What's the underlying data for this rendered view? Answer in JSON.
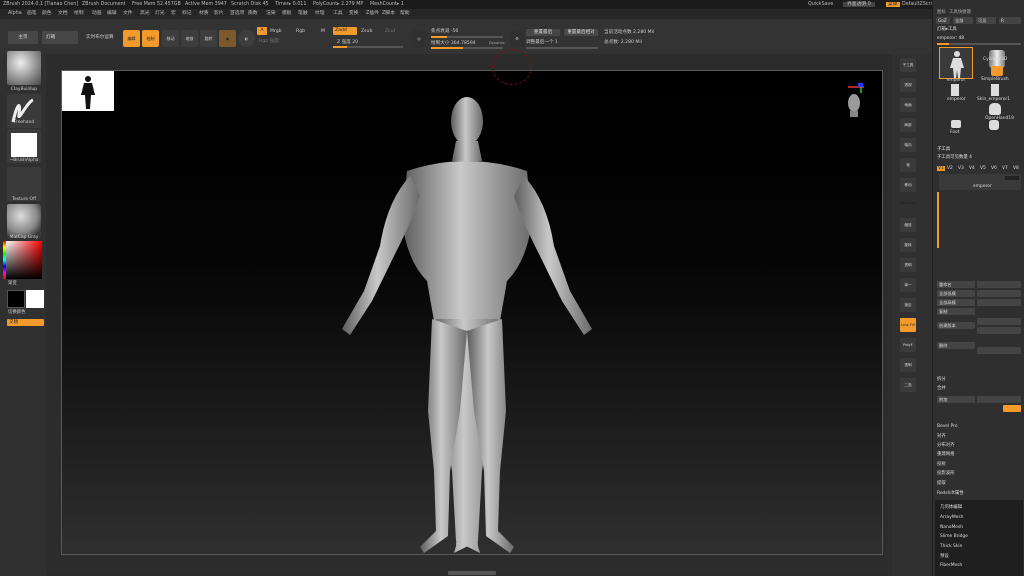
{
  "titlebar": {
    "app": "ZBrush 2024.0.1 [Tianao Chen]",
    "doc": "ZBrush Document",
    "free_mem": "Free Mem 52.457GB",
    "active_mem": "Active Mem 3947",
    "scratch": "Scratch Disk 45",
    "timer": "Timer▸ 0.011",
    "polycount": "PolyCount▸ 2.279 MP",
    "meshcount": "MeshCount▸ 1",
    "quicksave": "QuickSave",
    "transparency": "界面透明 0",
    "menu_label": "菜单",
    "script": "DefaultZScript"
  },
  "menus": [
    "Alpha",
    "画笔",
    "颜色",
    "文档",
    "绘制",
    "动画",
    "编辑",
    "文件",
    "高光",
    "灯光",
    "宏",
    "标记",
    "材质",
    "影片",
    "首选项",
    "质数",
    "渲染",
    "模板",
    "笔触",
    "纹理",
    "工具",
    "变换",
    "Z插件",
    "Z脚本",
    "帮助"
  ],
  "toolbar": {
    "home": "主页",
    "lightbox": "灯箱",
    "live_boolean": "实时布尔运算",
    "tools": [
      "编辑",
      "绘制",
      "移动",
      "缩放",
      "旋转"
    ],
    "a_label": "A",
    "mrgb": "Mrgb",
    "rgb": "Rgb",
    "m": "M",
    "zadd": "Zadd",
    "zsub": "Zsub",
    "zcut": "Zcut",
    "rgb_intensity": "Rgb 强度",
    "z_intensity_label": "Z 强度 20",
    "z_intensity": 0.2,
    "focal_label": "焦点衰减 -56",
    "focal": 0.22,
    "draw_size_label": "绘制大小 364.78594",
    "draw_size": 0.45,
    "dynamic": "Dynamic",
    "reset_last": "重置最后",
    "reset_last_relative": "重置最后相对",
    "adjust_last": "调整最后一个 1",
    "active_points": "当前活动点数 2.280 Mil",
    "total_points": "总点数: 2.280 Mil"
  },
  "leftshelf": {
    "brush": "ClayBuildup",
    "stroke": "Freehand",
    "alpha": "~BrushAlpha",
    "texture": "Texture Off",
    "material": "MatCap Gray",
    "color_label": "渐变",
    "swap_label": "切换颜色",
    "alternate": "交替"
  },
  "rightshelf": [
    "子工具",
    "透视",
    "地面",
    "局部",
    "轴向",
    "帧",
    "移动",
    "Dynamic",
    "缩放",
    "旋转",
    "透明",
    "单一",
    "锁定",
    "Line Fill",
    "PolyF",
    "透明",
    "二选"
  ],
  "panel": {
    "header_tabs": [
      "图标",
      "工具快捷键"
    ],
    "goz": "GoZ",
    "all": "全部",
    "visible": "可见",
    "lightbox_tools": "灯箱▸工具",
    "tool_name": "emperor: 48",
    "tools": [
      "emperor",
      "Cylinder3D",
      "SimpleBrush",
      "emperor",
      "Skin_emperor1",
      "OpenHand19",
      "Foot"
    ],
    "subtool_title": "子工具",
    "subtool_count": "子工具可见数量 4",
    "versions": [
      "V1",
      "V2",
      "V3",
      "V4",
      "V5",
      "V6",
      "V7",
      "V8"
    ],
    "subtool_item": "emperor",
    "list_items": [
      "重命名",
      "全部低模",
      "全部高模",
      "复制",
      "创建版本",
      "删除",
      "拆分",
      "Bevel Pro",
      "对齐",
      "分布对齐",
      "重建网格",
      "投射",
      "投影波形",
      "提取",
      "Redshift属性"
    ],
    "merge": "合并",
    "append": "附加",
    "geometry_title": "几何体编辑",
    "geometry_items": [
      "ArrayMesh",
      "NanoMesh",
      "Slime Bridge",
      "Thick Skin",
      "预设",
      "FiberMesh"
    ]
  }
}
